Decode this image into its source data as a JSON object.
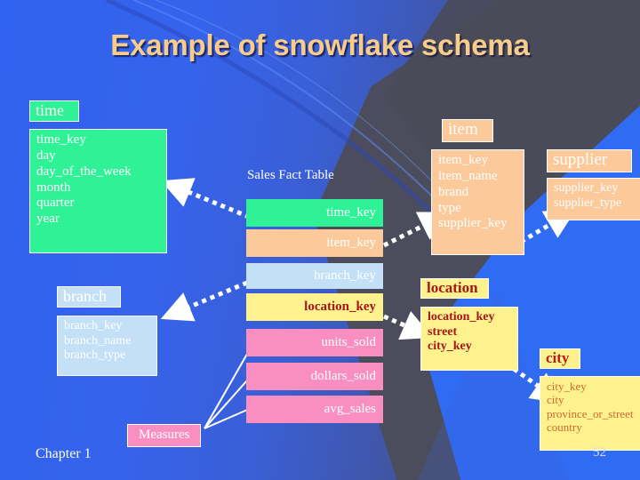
{
  "slide": {
    "title": "Example of snowflake schema",
    "chapter_label": "Chapter 1",
    "page_number": "52",
    "accent_title_color": "#f8cd8c",
    "background_blue": "#3366ee",
    "background_dark": "#4c4d5a"
  },
  "fact_table": {
    "caption": "Sales Fact Table",
    "rows": [
      {
        "label": "time_key",
        "color": "#2ff196",
        "text_color": "#ffffff"
      },
      {
        "label": "item_key",
        "color": "#fbc99a",
        "text_color": "#ffffff"
      },
      {
        "label": "branch_key",
        "color": "#c3e0f7",
        "text_color": "#ffffff"
      },
      {
        "label": "location_key",
        "color": "#fdf28d",
        "text_color": "#a5171b"
      },
      {
        "label": "units_sold",
        "color": "#f88fc0",
        "text_color": "#ffffff"
      },
      {
        "label": "dollars_sold",
        "color": "#f88fc0",
        "text_color": "#ffffff"
      },
      {
        "label": "avg_sales",
        "color": "#f88fc0",
        "text_color": "#ffffff"
      }
    ],
    "measures_label": "Measures"
  },
  "dimensions": {
    "time": {
      "name": "time",
      "color": "#2ff196",
      "fields": [
        "time_key",
        "day",
        "day_of_the_week",
        "month",
        "quarter",
        "year"
      ]
    },
    "item": {
      "name": "item",
      "color": "#fbc99a",
      "fields": [
        "item_key",
        "item_name",
        "brand",
        "type",
        "supplier_key"
      ]
    },
    "supplier": {
      "name": "supplier",
      "color": "#fbc99a",
      "fields": [
        "supplier_key",
        "supplier_type"
      ]
    },
    "branch": {
      "name": "branch",
      "color": "#c3e0f7",
      "fields": [
        "branch_key",
        "branch_name",
        "branch_type"
      ]
    },
    "location": {
      "name": "location",
      "color": "#fdf28d",
      "fields": [
        "location_key",
        "street",
        "city_key"
      ]
    },
    "city": {
      "name": "city",
      "color": "#fdf28d",
      "fields": [
        "city_key",
        "city",
        "province_or_street",
        "country"
      ]
    }
  }
}
